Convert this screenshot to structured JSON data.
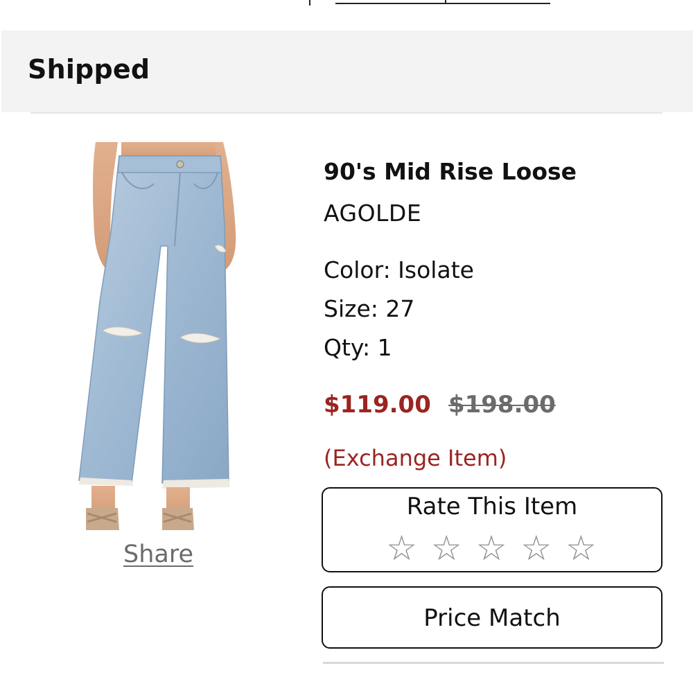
{
  "section": {
    "status": "Shipped"
  },
  "item": {
    "name": "90's Mid Rise Loose",
    "brand": "AGOLDE",
    "color_line": "Color: Isolate",
    "size_line": "Size: 27",
    "qty_line": "Qty: 1",
    "sale_price": "$119.00",
    "original_price": "$198.00",
    "note": "(Exchange Item)",
    "image_icon": "jeans-product-image"
  },
  "actions": {
    "share_label": "Share",
    "rate_title": "Rate This Item",
    "rating_stars": 0,
    "rating_max": 5,
    "price_match_label": "Price Match"
  },
  "colors": {
    "sale_red": "#9b2421",
    "header_bg": "#f3f3f3",
    "muted_gray": "#6b6b6b"
  }
}
